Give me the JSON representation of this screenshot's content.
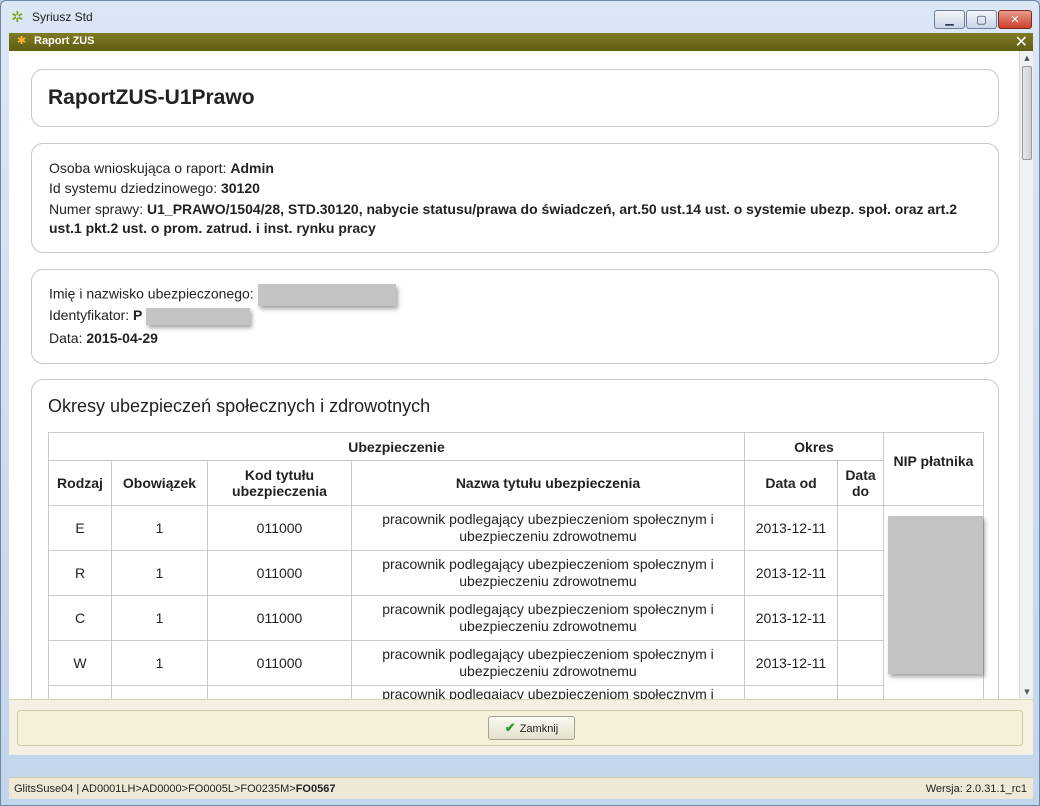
{
  "app": {
    "title": "Syriusz Std",
    "minimize": "▁",
    "maximize": "▢",
    "close": "✕"
  },
  "dialog": {
    "title": "Raport ZUS",
    "close": "✕"
  },
  "report": {
    "title": "RaportZUS-U1Prawo"
  },
  "request": {
    "requester_label": "Osoba wnioskująca o raport:",
    "requester_value": "Admin",
    "system_id_label": "Id systemu dziedzinowego:",
    "system_id_value": "30120",
    "case_number_label": "Numer sprawy:",
    "case_number_value": "U1_PRAWO/1504/28, STD.30120, nabycie statusu/prawa do świadczeń, art.50 ust.14 ust. o systemie ubezp. społ. oraz art.2 ust.1 pkt.2 ust. o prom. zatrud. i inst. rynku pracy"
  },
  "insured": {
    "name_label": "Imię i nazwisko ubezpieczonego:",
    "id_label": "Identyfikator:",
    "id_prefix": "P",
    "date_label": "Data:",
    "date_value": "2015-04-29"
  },
  "insurance": {
    "heading": "Okresy ubezpieczeń społecznych i zdrowotnych",
    "group_headers": {
      "insurance": "Ubezpieczenie",
      "period": "Okres",
      "nip": "NIP płatnika"
    },
    "columns": [
      "Rodzaj",
      "Obowiązek",
      "Kod tytułu ubezpieczenia",
      "Nazwa tytułu ubezpieczenia",
      "Data od",
      "Data do"
    ],
    "rows": [
      {
        "rodzaj": "E",
        "obowiazek": "1",
        "kod": "011000",
        "nazwa": "pracownik podlegający ubezpieczeniom społecznym i ubezpieczeniu zdrowotnemu",
        "data_od": "2013-12-11",
        "data_do": ""
      },
      {
        "rodzaj": "R",
        "obowiazek": "1",
        "kod": "011000",
        "nazwa": "pracownik podlegający ubezpieczeniom społecznym i ubezpieczeniu zdrowotnemu",
        "data_od": "2013-12-11",
        "data_do": ""
      },
      {
        "rodzaj": "C",
        "obowiazek": "1",
        "kod": "011000",
        "nazwa": "pracownik podlegający ubezpieczeniom społecznym i ubezpieczeniu zdrowotnemu",
        "data_od": "2013-12-11",
        "data_do": ""
      },
      {
        "rodzaj": "W",
        "obowiazek": "1",
        "kod": "011000",
        "nazwa": "pracownik podlegający ubezpieczeniom społecznym i ubezpieczeniu zdrowotnemu",
        "data_od": "2013-12-11",
        "data_do": ""
      },
      {
        "rodzaj": "",
        "obowiazek": "",
        "kod": "",
        "nazwa": "pracownik podlegający ubezpieczeniom społecznym i",
        "data_od": "",
        "data_do": ""
      }
    ]
  },
  "footer": {
    "close_button": "Zamknij"
  },
  "status": {
    "path": "GlitsSuse04 | AD0001LH>AD0000>FO0005L>FO0235M>",
    "current": "FO0567",
    "version": "Wersja: 2.0.31.1_rc1"
  }
}
